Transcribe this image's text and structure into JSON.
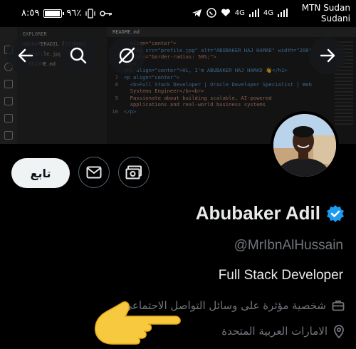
{
  "status_bar": {
    "time": "٨:٥٩",
    "battery_percent_text": "٩٦٪",
    "battery_level": 0.96,
    "network_1": "4G",
    "network_2": "4G",
    "carrier_line1": "MTN Sudan",
    "carrier_line2": "Sudani"
  },
  "banner": {
    "explorer_title": "EXPLORER",
    "explorer_items": [
      "ABUBAKERADIL [GITHUB]",
      "profile.jpg",
      "README.md"
    ],
    "editor_tab": "README.md",
    "code_lines": [
      {
        "n": "",
        "text": "  align=\"center\">"
      },
      {
        "n": "",
        "text": "  <img src=\"profile.jpg\" alt=\"ABUBAKER HAJ HAMAD\" width=\"200\""
      },
      {
        "n": "",
        "text": "  style=\"border-radius: 50%;\">"
      },
      {
        "n": "",
        "text": "</p>"
      },
      {
        "n": "",
        "text": ""
      },
      {
        "n": "",
        "text": "<h1 align=\"center\">Hi, I'm ABUBAKER HAJ HAMAD 👋</h1>"
      },
      {
        "n": "",
        "text": ""
      },
      {
        "n": "7",
        "text": "<p align=\"center\">"
      },
      {
        "n": "8",
        "text": "  <b>Full Stack Developer | Oracle Developer Specialist | Web"
      },
      {
        "n": "",
        "text": "  Systems Engineer</b><br>"
      },
      {
        "n": "9",
        "text": "  Passionate about building scalable, AI-powered"
      },
      {
        "n": "",
        "text": "  applications and real-world business systems"
      },
      {
        "n": "10",
        "text": "</p>"
      }
    ]
  },
  "nav": {
    "back_icon": "back-arrow-icon",
    "search_icon": "search-icon",
    "forward_icon": "forward-arrow-icon"
  },
  "profile": {
    "follow_label": "تابع",
    "display_name": "Abubaker Adil",
    "handle": "@MrIbnAlHussain",
    "bio": "Full Stack Developer",
    "category": "شخصية مؤثرة على وسائل التواصل الاجتماعي",
    "location": "الامارات العربية المتحدة",
    "verified_color": "#1d9bf0"
  },
  "colors": {
    "background": "#000000",
    "text_primary": "#e7e9ea",
    "text_secondary": "#71767b",
    "follow_bg": "#eff3f4"
  }
}
